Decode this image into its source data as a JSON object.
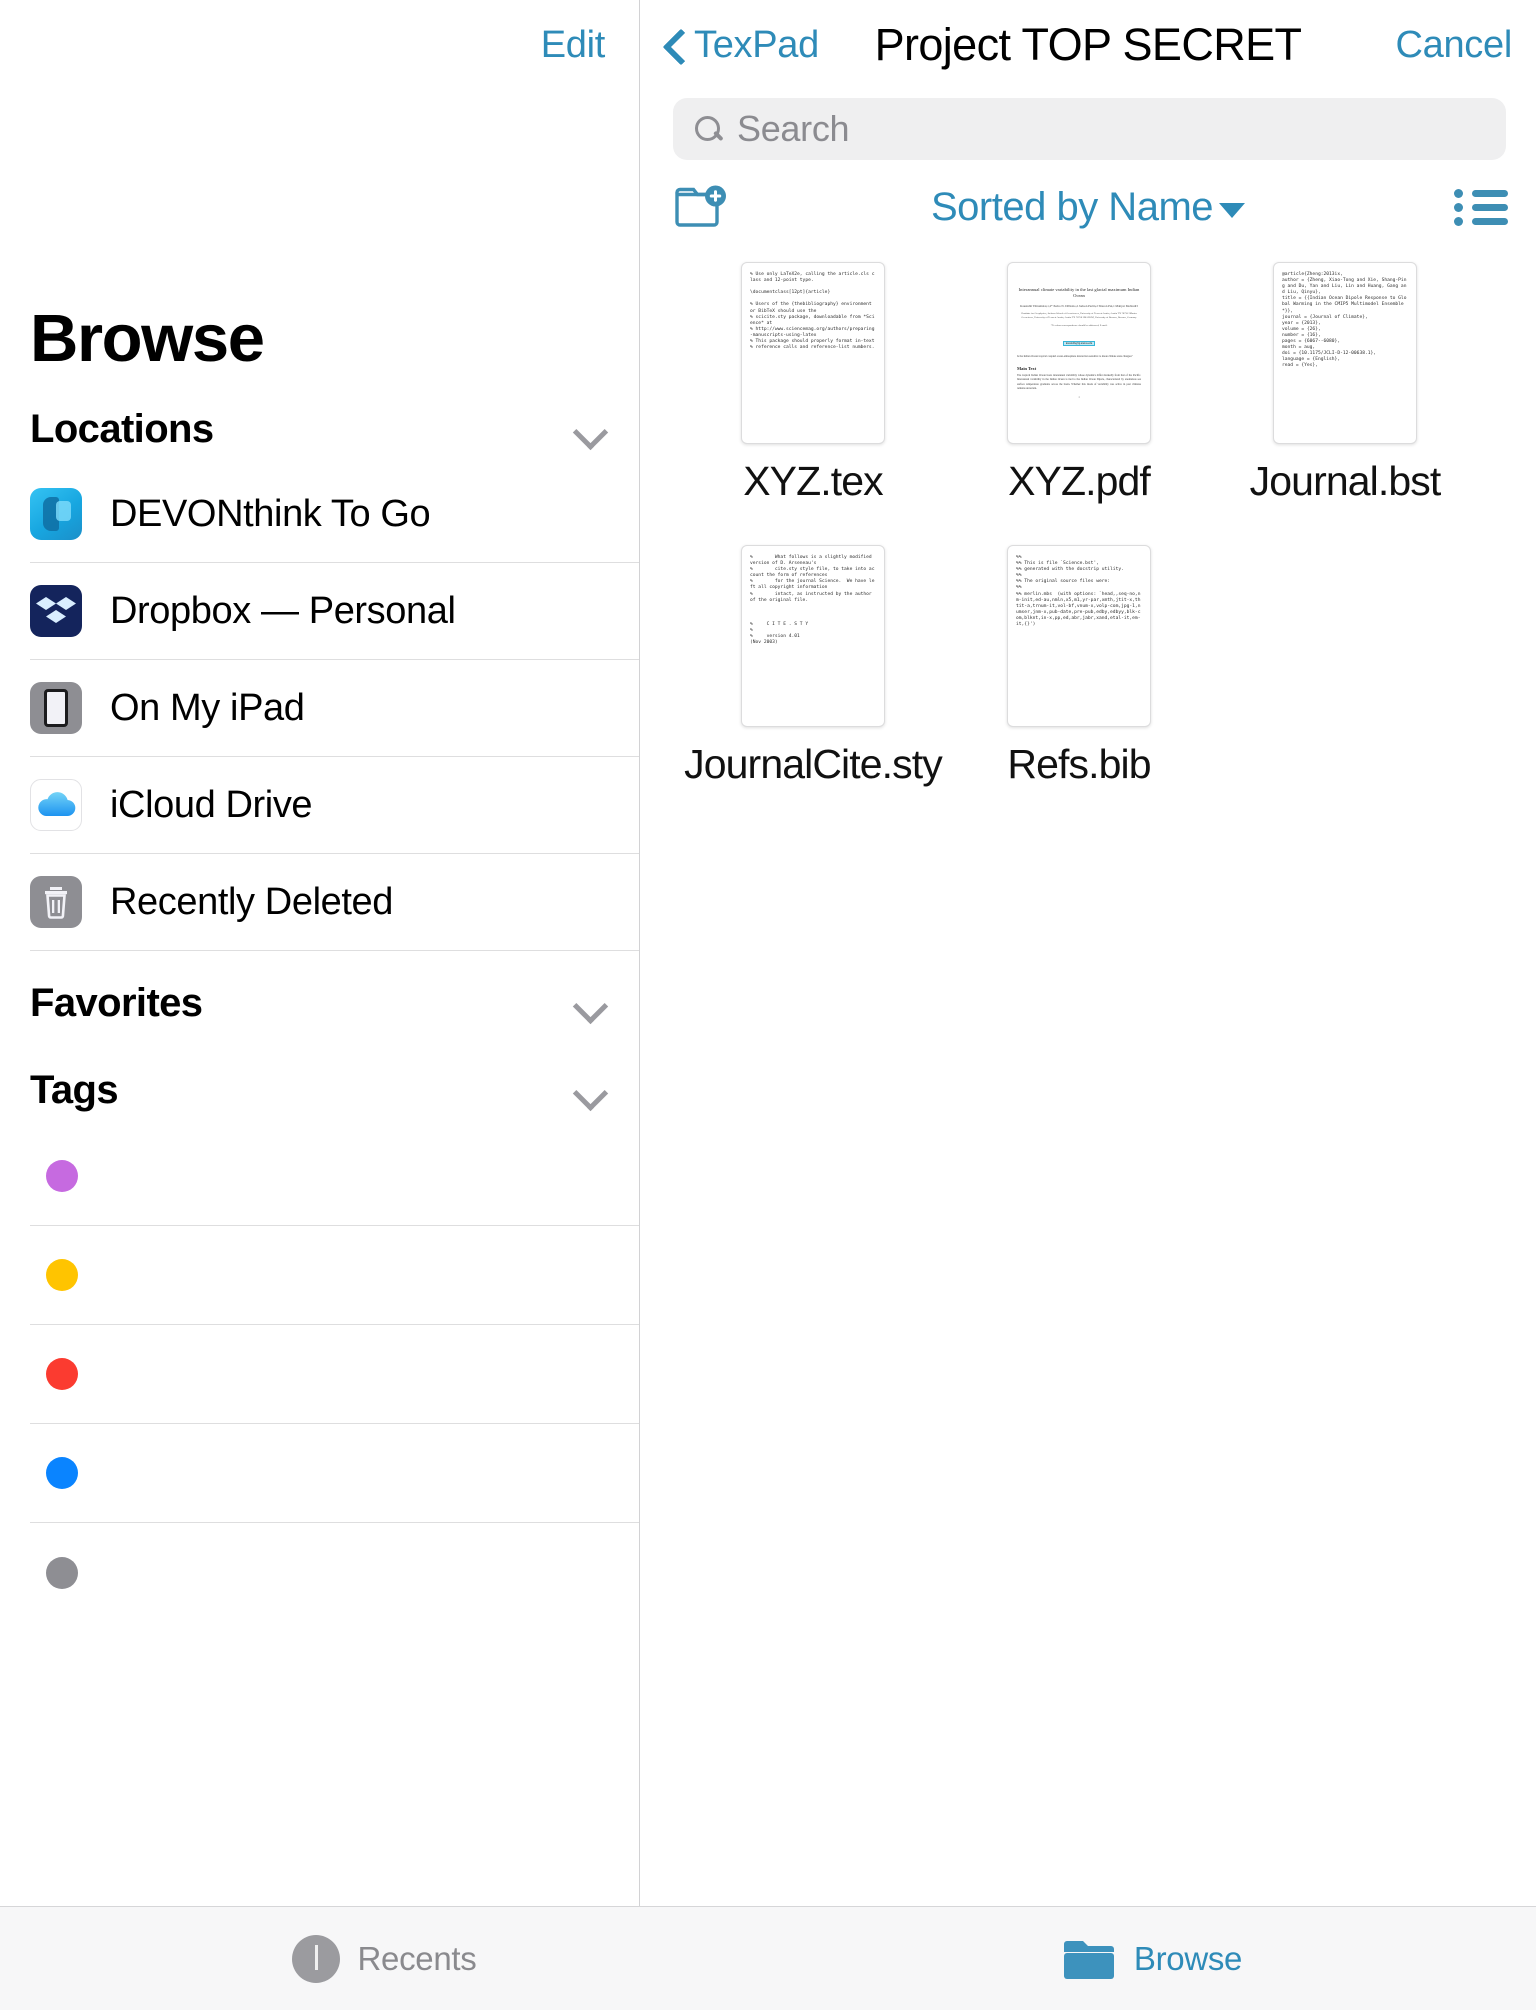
{
  "app": {
    "sidebar": {
      "edit_label": "Edit",
      "title": "Browse",
      "sections": [
        {
          "label": "Locations",
          "chevron": "chevron-down-icon"
        },
        {
          "label": "Favorites",
          "chevron": "chevron-down-icon"
        },
        {
          "label": "Tags",
          "chevron": "chevron-down-icon"
        }
      ],
      "locations": [
        {
          "label": "DEVONthink To Go",
          "icon": "devonthink-app-icon"
        },
        {
          "label": "Dropbox — Personal",
          "icon": "dropbox-app-icon"
        },
        {
          "label": "On My iPad",
          "icon": "ipad-device-icon"
        },
        {
          "label": "iCloud Drive",
          "icon": "icloud-drive-icon"
        },
        {
          "label": "Recently Deleted",
          "icon": "trash-icon"
        }
      ],
      "tags": [
        {
          "label": "",
          "color": "#c66ae0"
        },
        {
          "label": "",
          "color": "#ffc400"
        },
        {
          "label": "",
          "color": "#fb3b30"
        },
        {
          "label": "",
          "color": "#0a84ff"
        },
        {
          "label": "",
          "color": "#8e8e93"
        }
      ]
    },
    "content": {
      "back_label": "TexPad",
      "title": "Project TOP SECRET",
      "cancel_label": "Cancel",
      "search_placeholder": "Search",
      "search_value": "",
      "new_folder_icon": "new-folder-icon",
      "sort_label": "Sorted by Name",
      "list_view_icon": "list-view-icon",
      "files": [
        {
          "name": "XYZ.tex",
          "kind": "text",
          "preview": "% Use only LaTeX2e, calling the article.cls class and 12-point type.\n\n\\documentclass[12pt]{article}\n\n% Users of the {thebibliography} environment or BibTeX should use the\n% scicite.sty package, downloadable from *Science* at\n% http://www.sciencemag.org/authors/preparing-manuscripts-using-latex\n% This package should properly format in-text\n% reference calls and reference-list numbers."
        },
        {
          "name": "XYZ.pdf",
          "kind": "pdf",
          "paper_title": "Interannual climate variability in the last glacial maximum Indian Ocean",
          "paper_authors": "Kaustubh Thirumalai,1,2* Pedro N. DiNezio,2 Judson Partin,2 Sharon Pui,1 Mahyar Mohtadi3",
          "paper_affiliations": "1Institute for Geophysics, Jackson School of Geosciences, University of Texas at Austin, Austin TX 78758\n2Marine Geoscience, University of Texas at Austin, Austin TX 78758\n3MARUM, University of Bremen, Bremen, Germany",
          "paper_email_line": "*To whom correspondence should be addressed; E-mail:",
          "paper_email": "kaustubh@ig.utexas.edu",
          "paper_abstract": "Is the Indian Ocean tropical coupled ocean-atmosphere interaction sensitive to mean climate state changes?",
          "paper_section": "Main Text",
          "paper_page": "1"
        },
        {
          "name": "Journal.bst",
          "kind": "text",
          "preview": "@article{Zheng:2013ix,\nauthor = {Zheng, Xiao-Tong and Xie, Shang-Ping and Du, Yan and Liu, Lin and Huang, Gang and Liu, Qinyu},\ntitle = {{Indian Ocean Dipole Response to Global Warming in the CMIP5 Multimodel Ensemble*}},\njournal = {Journal of Climate},\nyear = {2013},\nvolume = {26},\nnumber = {16},\npages = {6067--6080},\nmonth = aug,\ndoi = {10.1175/JCLI-D-12-00638.1},\nlanguage = {English},\nread = {Yes},"
        },
        {
          "name": "JournalCite.sty",
          "kind": "text",
          "preview": "%        What follows is a slightly modified version of D. Arseneau's\n%        cite.sty style file, to take into account the form of references\n%        for the journal Science.  We have left all copyright information\n%        intact, as instructed by the author of the original file.\n\n\n\n%     C I T E . S T Y\n%\n%     version 4.01\n(Nov 2003)"
        },
        {
          "name": "Refs.bib",
          "kind": "text",
          "preview": "%%\n%% This is file `Science.bst',\n%% generated with the docstrip utility.\n%%\n%% The original source files were:\n%%\n%% merlin.mbs  (with options: `head,,seq-no,nm-init,ed-au,nmln,x5,m1,yr-par,xmth,jtit-x,thtit-a,trnum-it,vol-bf,vnum-x,volp-com,jpg-1,numser,jnm-x,pub-date,pre-pub,edby,edbyy,blk-com,blknt,in-x,pp,ed,abr,jabr,xand,etal-it,em-it,{}')"
        }
      ]
    },
    "tabbar": {
      "tabs": [
        {
          "label": "Recents",
          "icon": "clock-icon",
          "active": false
        },
        {
          "label": "Browse",
          "icon": "folder-icon",
          "active": true
        }
      ]
    },
    "colors": {
      "accent": "#2e8bb8",
      "separator": "#dededf",
      "search_bg": "#efeff0"
    }
  }
}
